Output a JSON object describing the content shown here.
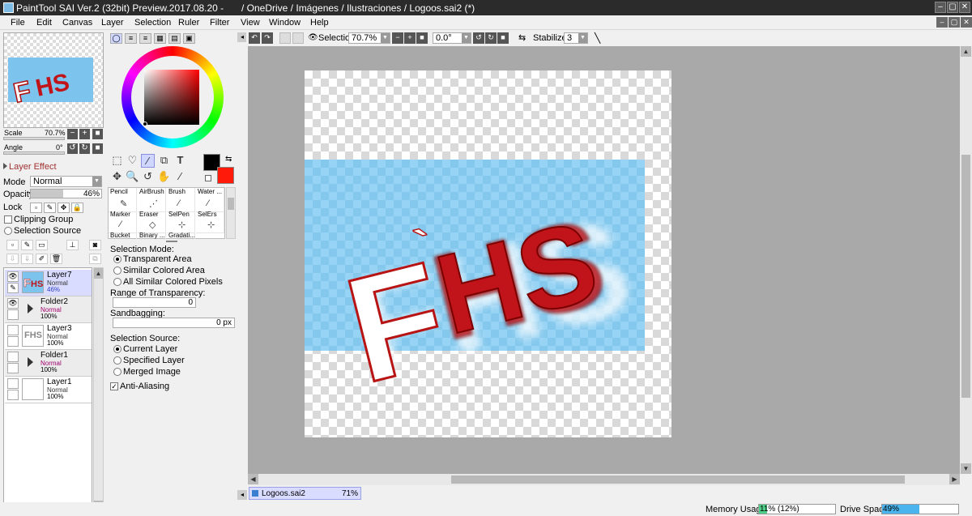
{
  "window": {
    "app_title": "PaintTool SAI Ver.2 (32bit) Preview.2017.08.20 -",
    "path": "/ OneDrive / Imágenes / Ilustraciones / Logoos.sai2 (*)"
  },
  "menu": [
    "File",
    "Edit",
    "Canvas",
    "Layer",
    "Selection",
    "Ruler",
    "Filter",
    "View",
    "Window",
    "Help"
  ],
  "navigator": {
    "scale_label": "Scale",
    "scale_value": "70.7%",
    "angle_label": "Angle",
    "angle_value": "0°"
  },
  "layer_props": {
    "effect_label": "Layer Effect",
    "mode_label": "Mode",
    "mode_value": "Normal",
    "opacity_label": "Opacity",
    "opacity_value": "46%",
    "opacity_level": 0.46,
    "lock_label": "Lock",
    "clipping_group": "Clipping Group",
    "selection_source": "Selection Source"
  },
  "layers": [
    {
      "name": "Layer7",
      "mode": "Normal",
      "opacity": "46%",
      "type": "layer",
      "selected": true
    },
    {
      "name": "Folder2",
      "mode": "Normal",
      "opacity": "100%",
      "type": "folder"
    },
    {
      "name": "Layer3",
      "mode": "Normal",
      "opacity": "100%",
      "type": "layer",
      "thumb_text": "FHS"
    },
    {
      "name": "Folder1",
      "mode": "Normal",
      "opacity": "100%",
      "type": "folder"
    },
    {
      "name": "Layer1",
      "mode": "Normal",
      "opacity": "100%",
      "type": "layer"
    }
  ],
  "colors": {
    "primary": "#000000",
    "secondary": "#ff1a0a",
    "canvas_bg": "#a9a9a9",
    "selected_layer": "#d9dcff",
    "logo_red": "#c0141a"
  },
  "brushes": [
    {
      "label": "Pencil",
      "icon": "pencil-icon"
    },
    {
      "label": "AirBrush",
      "icon": "airbrush-icon"
    },
    {
      "label": "Brush",
      "icon": "brush-icon"
    },
    {
      "label": "Water ...",
      "icon": "water-icon"
    },
    {
      "label": "Marker",
      "icon": "marker-icon"
    },
    {
      "label": "Eraser",
      "icon": "eraser-icon"
    },
    {
      "label": "SelPen",
      "icon": "selpen-icon"
    },
    {
      "label": "SelErs",
      "icon": "selers-icon"
    },
    {
      "label": "Bucket",
      "icon": "bucket-icon"
    },
    {
      "label": "Binary ...",
      "icon": "binary-icon"
    },
    {
      "label": "Gradati...",
      "icon": "gradation-icon"
    },
    {
      "label": "",
      "icon": ""
    }
  ],
  "tool_options": {
    "selection_mode_label": "Selection Mode:",
    "modes": [
      "Transparent Area",
      "Similar Colored Area",
      "All Similar Colored Pixels"
    ],
    "range_label": "Range of Transparency:",
    "range_value": "0",
    "sandbagging_label": "Sandbagging:",
    "sandbagging_value": "0 px",
    "source_label": "Selection Source:",
    "sources": [
      "Current Layer",
      "Specified Layer",
      "Merged Image"
    ],
    "anti_aliasing": "Anti-Aliasing"
  },
  "toolbar": {
    "selection_label": "Selection",
    "zoom_value": "70.7%",
    "angle_value": "0.0°",
    "stabilizer_label": "Stabilizer",
    "stabilizer_value": "3"
  },
  "canvas": {
    "logo_text": "FHS",
    "logo_accent": "`"
  },
  "doc_tab": {
    "name": "Logoos.sai2",
    "zoom": "71%"
  },
  "status": {
    "memory_label": "Memory Usage",
    "memory_value": "11% (12%)",
    "memory_level": 0.11,
    "drive_label": "Drive Space",
    "drive_value": "49%",
    "drive_level": 0.49
  }
}
